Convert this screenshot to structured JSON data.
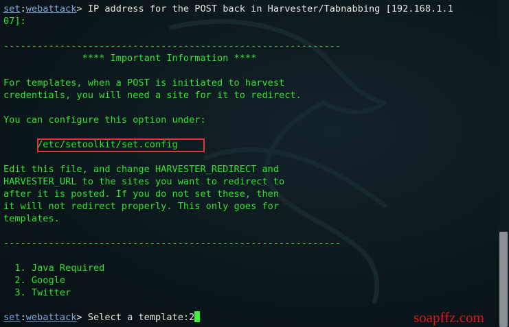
{
  "prompt": {
    "user": "set",
    "separator": ":",
    "module": "webattack",
    "symbol": ">"
  },
  "line1_text": " IP address for the POST back in Harvester/Tabnabbing [192.168.1.1",
  "line2_text": "07]:",
  "rule_text": "------------------------------------------------------------",
  "info_title": "              **** Important Information ****",
  "para1_line1": "For templates, when a POST is initiated to harvest",
  "para1_line2": "credentials, you will need a site for it to redirect.",
  "para2_line1": "You can configure this option under:",
  "config_path": "      /etc/setoolkit/set.config",
  "para3_lines": [
    "Edit this file, and change HARVESTER_REDIRECT and",
    "HARVESTER_URL to the sites you want to redirect to",
    "after it is posted. If you do not set these, then",
    "it will not redirect properly. This only goes for",
    "templates."
  ],
  "menu_items": [
    "  1. Java Required",
    "  2. Google",
    "  3. Twitter"
  ],
  "select_prompt_text": " Select a template:",
  "select_input_value": "2",
  "watermark": "soapffz.com",
  "colors": {
    "background": "#0c181d",
    "text_green": "#2fe32f",
    "prompt_blue": "#7fa7d6",
    "highlight_red": "#e0363a",
    "watermark_red": "#d6191f"
  }
}
